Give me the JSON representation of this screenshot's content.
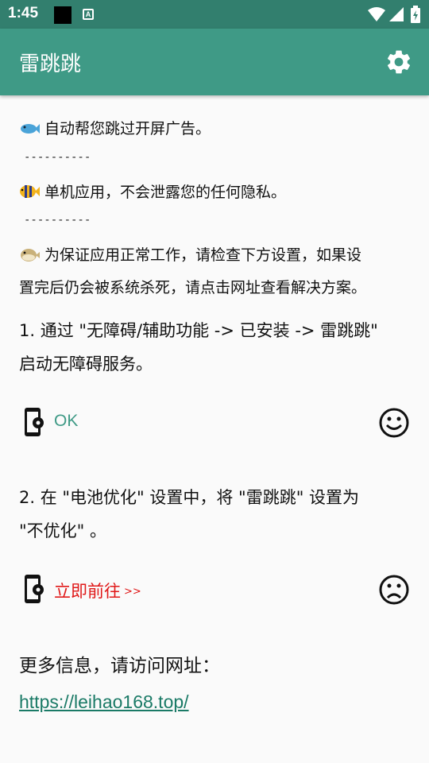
{
  "status_bar": {
    "time": "1:45",
    "icons": [
      "notification-square-icon",
      "font-a-icon",
      "wifi-icon",
      "signal-icon",
      "battery-icon"
    ]
  },
  "app_bar": {
    "title": "雷跳跳",
    "settings_icon": "gear-icon",
    "color": "#3f9a86"
  },
  "intro": {
    "line1": "自动帮您跳过开屏广告。",
    "separator1": "----------",
    "line2": "单机应用，不会泄露您的任何隐私。",
    "separator2": "----------",
    "line3a": "为保证应用正常工作，请检查下方设置，如果设",
    "line3b": "置完后仍会被系统杀死，请点击网址查看解决方案。"
  },
  "step1": {
    "text_line1": "1. 通过 \"无障碍/辅助功能 -> 已安装 -> 雷跳跳\"",
    "text_line2": "启动无障碍服务。",
    "action_label": "OK",
    "status_icon": "happy-face-icon",
    "color": "#3f9a86"
  },
  "step2": {
    "text_line1": "2. 在 \"电池优化\" 设置中，将 \"雷跳跳\" 设置为",
    "text_line2": "\"不优化\" 。",
    "action_label": "立即前往",
    "action_arrows": ">>",
    "status_icon": "sad-face-icon",
    "color": "#e01818"
  },
  "footer": {
    "more_info": "更多信息，请访问网址：",
    "url": "https://leihao168.top/"
  }
}
